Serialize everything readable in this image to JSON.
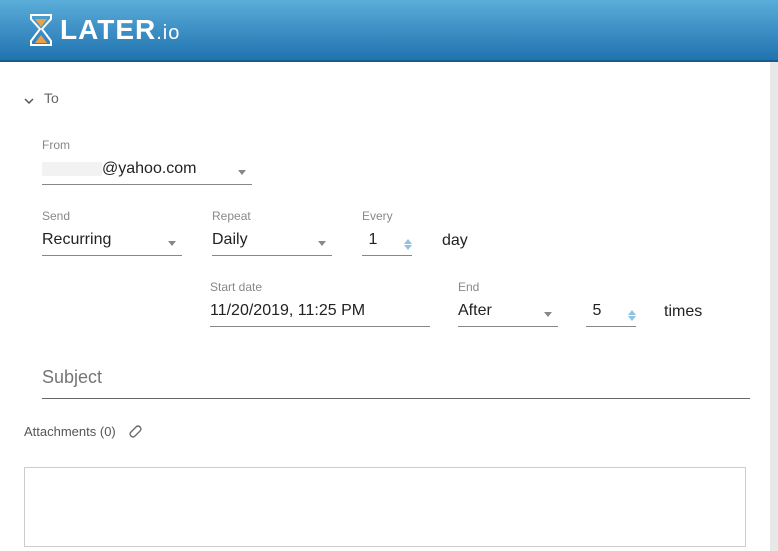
{
  "header": {
    "brand_main": "LATER",
    "brand_suffix": ".io"
  },
  "compose": {
    "to_label": "To",
    "from_label": "From",
    "from_value": "@yahoo.com",
    "send_label": "Send",
    "send_value": "Recurring",
    "repeat_label": "Repeat",
    "repeat_value": "Daily",
    "every_label": "Every",
    "every_value": "1",
    "every_unit": "day",
    "start_label": "Start date",
    "start_value": "11/20/2019, 11:25 PM",
    "end_label": "End",
    "end_value": "After",
    "times_value": "5",
    "times_unit": "times",
    "subject_placeholder": "Subject",
    "attachments_label": "Attachments (0)"
  }
}
